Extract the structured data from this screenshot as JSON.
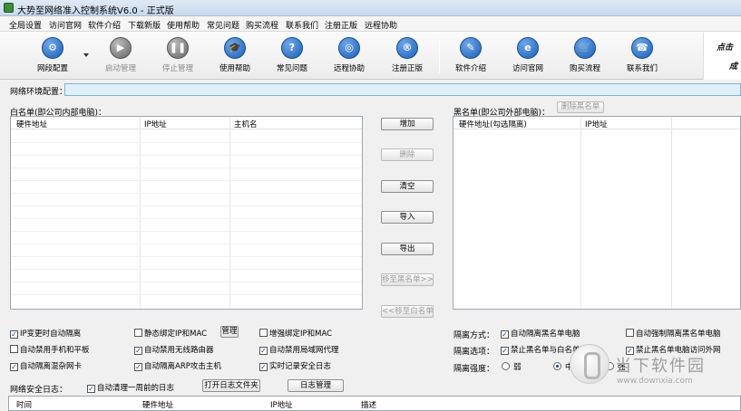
{
  "window": {
    "title": "大势至网络准入控制系统V6.0 - 正式版"
  },
  "menu": [
    "全局设置",
    "访问官网",
    "软件介绍",
    "下载新版",
    "使用帮助",
    "常见问题",
    "购买流程",
    "联系我们",
    "注册正版",
    "远程协助"
  ],
  "toolbar": [
    {
      "label": "网段配置",
      "icon": "gear-icon",
      "glyph": "⚙",
      "enabled": true
    },
    {
      "label": "启动管理",
      "icon": "play-icon",
      "glyph": "▶",
      "enabled": false
    },
    {
      "label": "停止管理",
      "icon": "pause-icon",
      "glyph": "❚❚",
      "enabled": false
    },
    {
      "label": "使用帮助",
      "icon": "graduation-cap-icon",
      "glyph": "🎓",
      "enabled": true
    },
    {
      "label": "常见问题",
      "icon": "question-icon",
      "glyph": "?",
      "enabled": true
    },
    {
      "label": "远程协助",
      "icon": "globe-icon",
      "glyph": "◎",
      "enabled": true
    },
    {
      "label": "注册正版",
      "icon": "registered-icon",
      "glyph": "®",
      "enabled": true
    },
    {
      "label": "软件介绍",
      "icon": "document-icon",
      "glyph": "✎",
      "enabled": true
    },
    {
      "label": "访问官网",
      "icon": "browser-icon",
      "glyph": "e",
      "enabled": true
    },
    {
      "label": "购买流程",
      "icon": "cart-icon",
      "glyph": "🛒",
      "enabled": true
    },
    {
      "label": "联系我们",
      "icon": "phone-icon",
      "glyph": "☎",
      "enabled": true
    }
  ],
  "calligraphy": {
    "top": "点击",
    "bottom": "成"
  },
  "network_config": {
    "label": "网络环境配置：",
    "value": ""
  },
  "whitelist": {
    "label": "白名单(即公司内部电脑)：",
    "columns": [
      "硬件地址",
      "IP地址",
      "主机名"
    ]
  },
  "blacklist": {
    "label": "黑名单(即公司外部电脑)：",
    "delete_button": "删除黑名单",
    "columns": [
      "硬件地址(勾选隔离)",
      "IP地址"
    ]
  },
  "middle_buttons": [
    {
      "label": "增加",
      "enabled": true
    },
    {
      "label": "删除",
      "enabled": false
    },
    {
      "label": "清空",
      "enabled": true
    },
    {
      "label": "导入",
      "enabled": true
    },
    {
      "label": "导出",
      "enabled": true
    },
    {
      "label": "移至黑名单>>",
      "enabled": false
    },
    {
      "label": "<<移至白名单",
      "enabled": false
    }
  ],
  "options_left": [
    {
      "label": "IP变更时自动隔离",
      "checked": true
    },
    {
      "label": "静态绑定IP和MAC",
      "checked": false
    },
    {
      "label": "增强绑定IP和MAC",
      "checked": false
    },
    {
      "label": "自动禁用手机和平板",
      "checked": false
    },
    {
      "label": "自动禁用无线路由器",
      "checked": true
    },
    {
      "label": "自动禁用局域网代理",
      "checked": true
    },
    {
      "label": "自动隔离混杂网卡",
      "checked": true
    },
    {
      "label": "自动隔离ARP攻击主机",
      "checked": true
    },
    {
      "label": "实时记录安全日志",
      "checked": true
    }
  ],
  "manage_button": "管理",
  "isolation": {
    "method_label": "隔离方式：",
    "method_options": [
      {
        "label": "自动隔离黑名单电脑",
        "checked": true
      },
      {
        "label": "自动强制隔离黑名单电脑",
        "checked": false
      }
    ],
    "options_label": "隔离选项：",
    "options": [
      {
        "label": "禁止黑名单与白名单互访",
        "checked": true
      },
      {
        "label": "禁止黑名单电脑访问外网",
        "checked": true
      }
    ],
    "strength_label": "隔离强度：",
    "strength": [
      {
        "label": "弱",
        "selected": false
      },
      {
        "label": "中",
        "selected": true
      },
      {
        "label": "强",
        "selected": false
      }
    ]
  },
  "log": {
    "label": "网络安全日志：",
    "auto_clean": {
      "label": "自动清理一周前的日志",
      "checked": true
    },
    "open_folder_button": "打开日志文件夹",
    "manage_button": "日志管理",
    "columns": [
      "时间",
      "硬件地址",
      "IP地址",
      "描述"
    ]
  },
  "watermark": {
    "name": "当下软件园",
    "url": "www.downxia.com"
  },
  "colors": {
    "accent": "#1c5fb6",
    "input_bg": "#dff0fb",
    "titlebar": "#c9daee"
  }
}
